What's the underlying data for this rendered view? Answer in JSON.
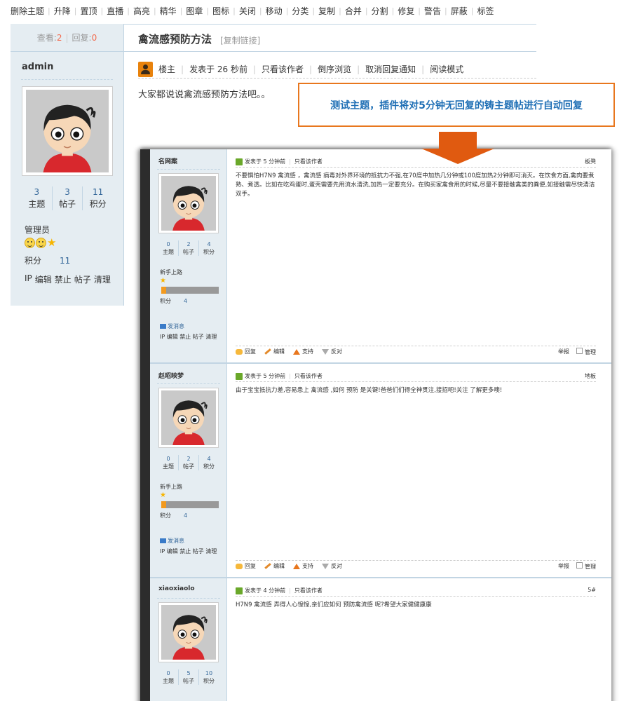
{
  "toolbar": {
    "items": [
      "删除主题",
      "升降",
      "置顶",
      "直播",
      "高亮",
      "精华",
      "图章",
      "图标",
      "关闭",
      "移动",
      "分类",
      "复制",
      "合并",
      "分割",
      "修复",
      "警告",
      "屏蔽",
      "标签"
    ]
  },
  "thread": {
    "views_label": "查看:",
    "views": "2",
    "replies_label": "回复:",
    "replies": "0",
    "title": "禽流感预防方法",
    "copy_link": "[复制链接]"
  },
  "author": {
    "name": "admin",
    "topics": "3",
    "topics_label": "主题",
    "posts": "3",
    "posts_label": "帖子",
    "credits": "11",
    "credits_label": "积分",
    "group": "管理员",
    "points_label": "积分",
    "points": "11",
    "links": [
      "IP",
      "编辑",
      "禁止",
      "帖子",
      "清理"
    ]
  },
  "post_bar": {
    "floor": "楼主",
    "posted": "发表于 26 秒前",
    "only_author": "只看该作者",
    "reverse": "倒序浏览",
    "cancel_notify": "取消回复通知",
    "read_mode": "阅读模式"
  },
  "content": "大家都说说禽流感预防方法吧。。",
  "callout": "测试主题，插件将对5分钟无回复的铸主题帖进行自动回复",
  "inner": {
    "stats_labels": [
      "主题",
      "帖子",
      "积分"
    ],
    "group": "新手上路",
    "points_label": "积分",
    "send_msg": "发消息",
    "links": "IP 编辑 禁止 帖子 清理",
    "only_author": "只看该作者",
    "footer": {
      "reply": "回复",
      "edit": "编辑",
      "support": "支持",
      "oppose": "反对",
      "report": "举报",
      "manage": "管理"
    },
    "posts": [
      {
        "name": "名网案",
        "stats": [
          "0",
          "2",
          "4"
        ],
        "points": "4",
        "posted": "发表于 5 分钟前",
        "floor": "板凳",
        "body": "不要惧怕H7N9 禽流感 ，禽流感 病毒对外界环境的抵抗力不强,在70度中加热几分钟或100度加热2分钟即可消灭。在饮食方面,禽肉要煮熟、煮透。比如在吃鸡蛋时,蛋壳需要先用流水清洗,加热一定要充分。在购买家禽食用的时候,尽量不要接触禽类的粪便,如接触需尽快清洁双手。"
      },
      {
        "name": "赵昭映梦",
        "stats": [
          "0",
          "2",
          "4"
        ],
        "points": "4",
        "posted": "发表于 5 分钟前",
        "floor": "地板",
        "body": "由于宝宝抵抗力差,容易患上 禽流感 ,如何 预防 是关键!爸爸们们得全神贯注,接招吧!关注 了解更多噢!"
      },
      {
        "name": "xiaoxiaolo",
        "stats": [
          "0",
          "5",
          "10"
        ],
        "points": "10",
        "posted": "发表于 4 分钟前",
        "floor": "5#",
        "body": "H7N9 禽流感 弄得人心惶惶,亲们应如何 预防禽流感 呢?希望大家健健康康"
      }
    ]
  }
}
